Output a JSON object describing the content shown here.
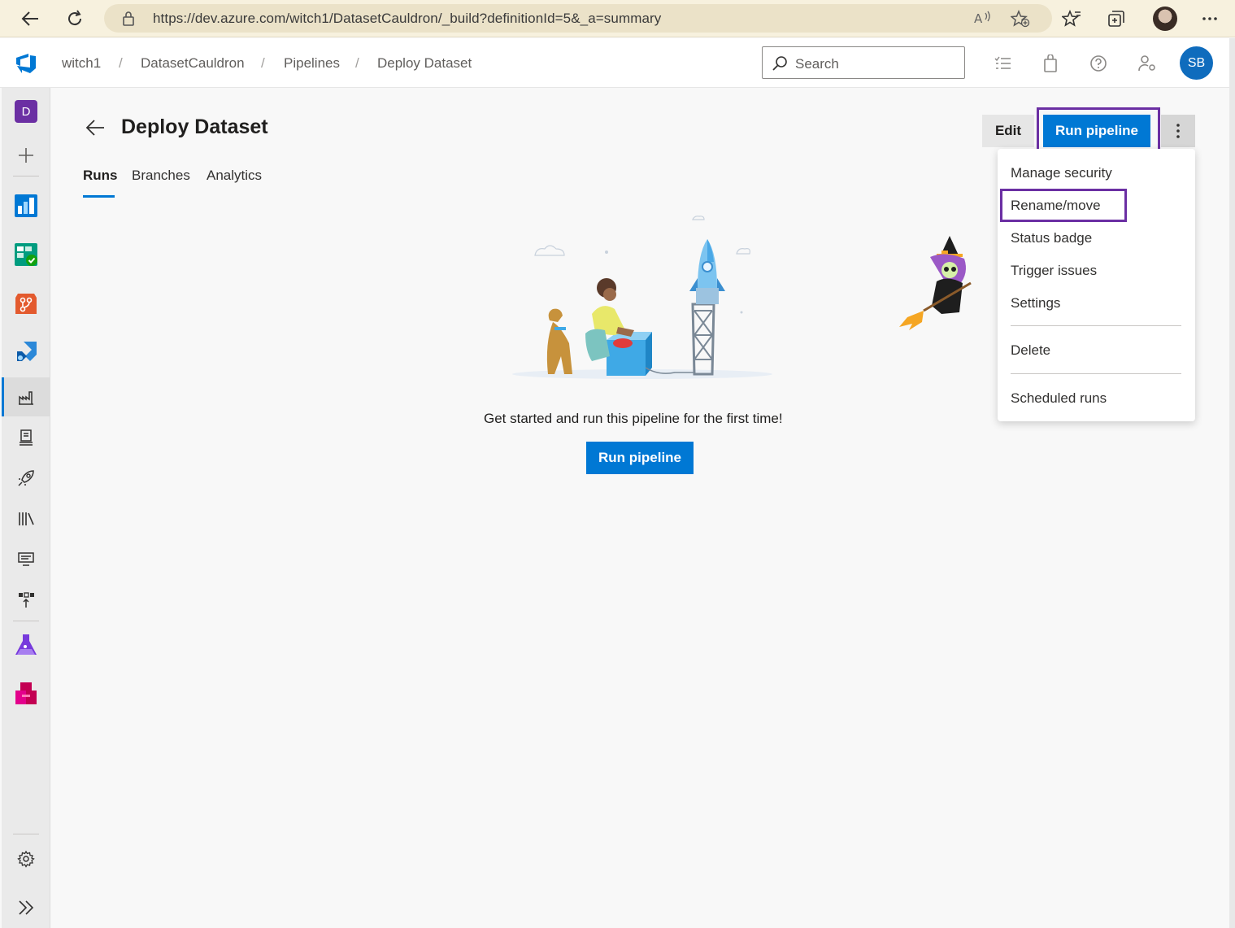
{
  "browser": {
    "url": "https://dev.azure.com/witch1/DatasetCauldron/_build?definitionId=5&_a=summary"
  },
  "header": {
    "breadcrumbs": [
      "witch1",
      "DatasetCauldron",
      "Pipelines",
      "Deploy Dataset"
    ],
    "separator": "/",
    "search_placeholder": "Search",
    "avatar_initials": "SB"
  },
  "rail": {
    "project_badge": "D",
    "items": [
      "overview-icon",
      "boards-icon",
      "test-plans-icon",
      "repos-icon",
      "pipelines-icon",
      "pipelines-sub-icon",
      "environments-icon",
      "releases-icon",
      "library-icon",
      "task-groups-icon",
      "deployment-groups-icon",
      "test-plans-flask-icon",
      "artifacts-icon",
      "settings-icon",
      "expand-icon"
    ]
  },
  "page": {
    "title": "Deploy Dataset",
    "tabs": [
      {
        "label": "Runs",
        "active": true
      },
      {
        "label": "Branches",
        "active": false
      },
      {
        "label": "Analytics",
        "active": false
      }
    ],
    "edit_label": "Edit",
    "run_pipeline_label": "Run pipeline",
    "empty_message": "Get started and run this pipeline for the first time!",
    "run_pipeline_main_label": "Run pipeline"
  },
  "menu": {
    "items": [
      "Manage security",
      "Rename/move",
      "Status badge",
      "Trigger issues",
      "Settings",
      "Delete",
      "Scheduled runs"
    ],
    "highlighted": "Rename/move"
  },
  "colors": {
    "accent": "#0078d4",
    "highlight_outline": "#6b2fa3",
    "browser_bar": "#f7f1de"
  }
}
